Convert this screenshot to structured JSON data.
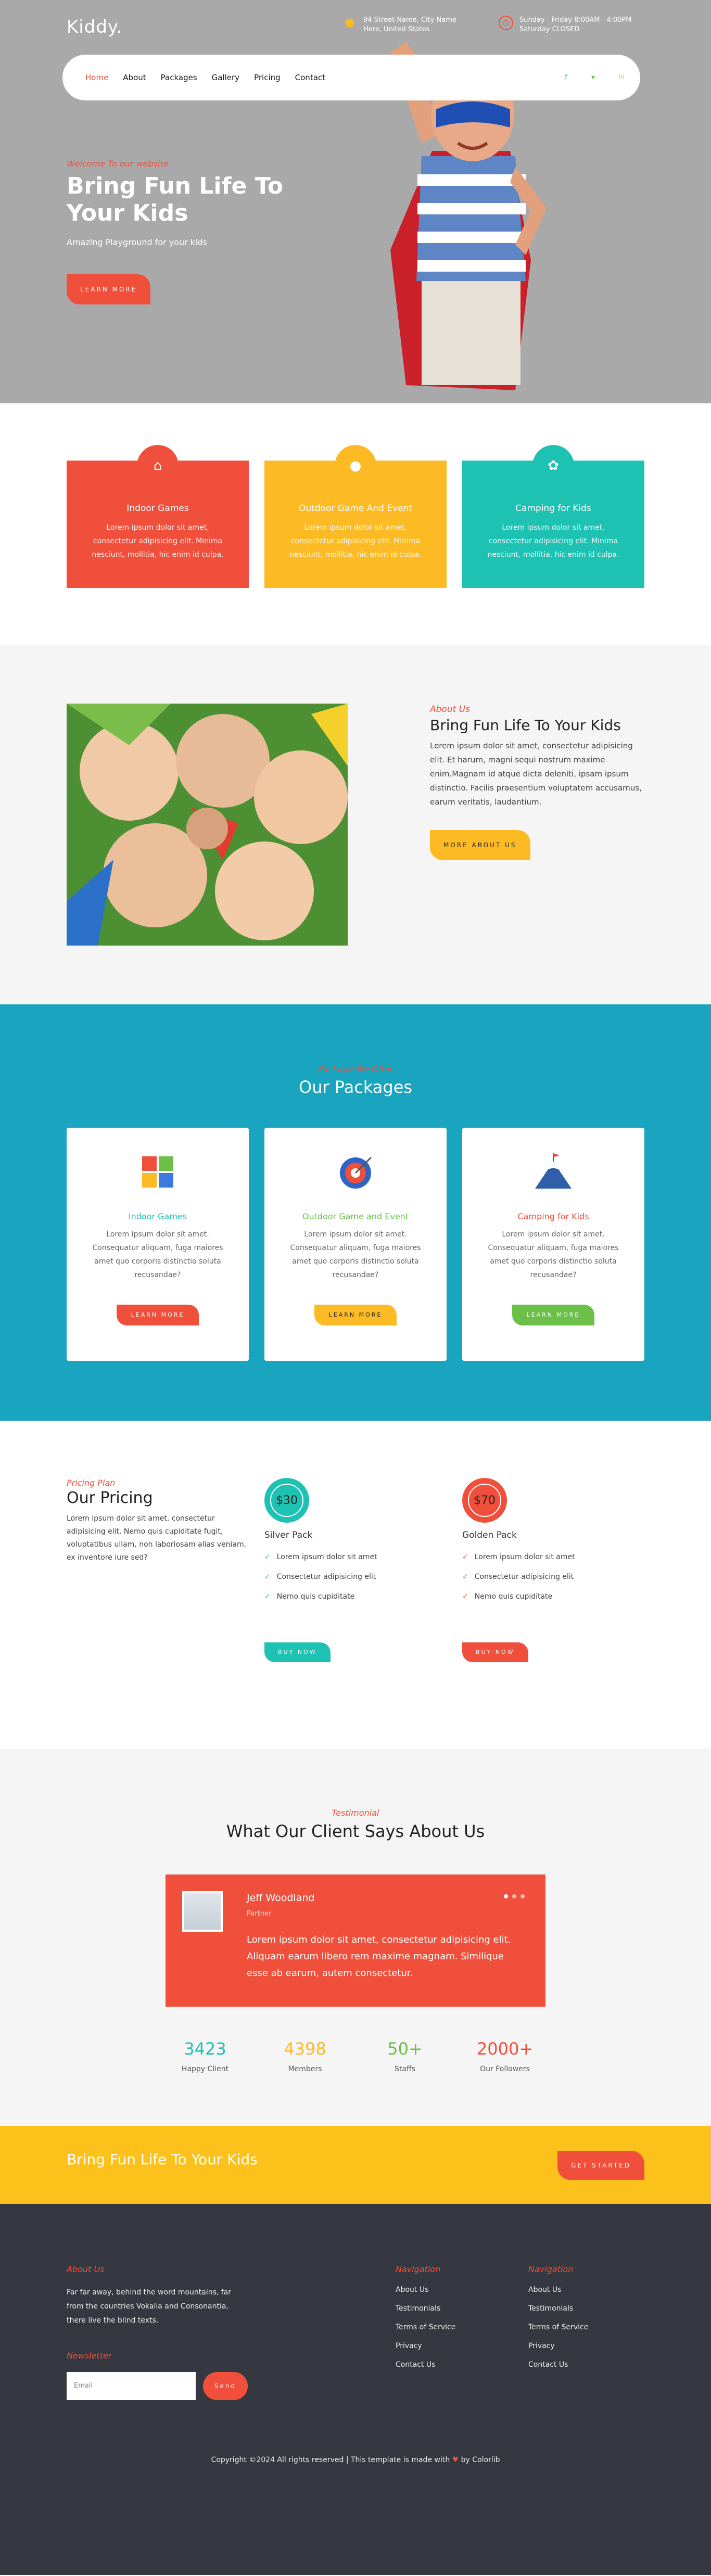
{
  "brand": {
    "logo": "Kiddy"
  },
  "topbar": {
    "address": "94 Street Name, City Name Here, United States",
    "hours": "Sunday - Friday 8:00AM - 4:00PM Saturday CLOSED"
  },
  "nav": {
    "items": [
      {
        "label": "Home",
        "active": true
      },
      {
        "label": "About"
      },
      {
        "label": "Packages"
      },
      {
        "label": "Gallery"
      },
      {
        "label": "Pricing"
      },
      {
        "label": "Contact"
      }
    ],
    "socials": [
      {
        "icon": "facebook-icon",
        "glyph": "f",
        "color": "#1ec2b3"
      },
      {
        "icon": "twitter-icon",
        "glyph": "▼",
        "color": "#6cc04a"
      },
      {
        "icon": "linkedin-icon",
        "glyph": "in",
        "color": "#fcba24"
      }
    ]
  },
  "hero": {
    "welcome": "Welcome To our website",
    "title_line1": "Bring Fun Life To",
    "title_line2": "Your Kids",
    "subtitle": "Amazing Playground for your kids",
    "button": "Learn More"
  },
  "services": [
    {
      "icon": "home-icon",
      "title": "Indoor Games",
      "text": "Lorem ipsum dolor sit amet, consectetur adipisicing elit. Minima nesciunt, mollitia, hic enim id culpa."
    },
    {
      "icon": "user-icon",
      "title": "Outdoor Game And Event",
      "text": "Lorem ipsum dolor sit amet, consectetur adipisicing elit. Minima nesciunt, mollitia, hic enim id culpa."
    },
    {
      "icon": "gear-icon",
      "title": "Camping for Kids",
      "text": "Lorem ipsum dolor sit amet, consectetur adipisicing elit. Minima nesciunt, mollitia, hic enim id culpa."
    }
  ],
  "about": {
    "label": "About Us",
    "title": "Bring Fun Life To Your Kids",
    "text": "Lorem ipsum dolor sit amet, consectetur adipisicing elit. Et harum, magni sequi nostrum maxime enim.Magnam id atque dicta deleniti, ipsam ipsum distinctio. Facilis praesentium voluptatem accusamus, earum veritatis, laudantium.",
    "button": "More About Us"
  },
  "packages": {
    "label": "Package We Offer",
    "title": "Our Packages",
    "items": [
      {
        "icon": "puzzle-icon",
        "title": "Indoor Games",
        "title_color": "#1ec2b3",
        "text": "Lorem ipsum dolor sit amet. Consequatur aliquam, fuga maiores amet quo corporis distinctio soluta recusandae?",
        "button": "Learn More",
        "btn_color": "#f0503b"
      },
      {
        "icon": "target-icon",
        "title": "Outdoor Game and Event",
        "title_color": "#6cc04a",
        "text": "Lorem ipsum dolor sit amet. Consequatur aliquam, fuga maiores amet quo corporis distinctio soluta recusandae?",
        "button": "Learn More",
        "btn_color": "#fcba24"
      },
      {
        "icon": "mountain-icon",
        "title": "Camping for Kids",
        "title_color": "#f0503b",
        "text": "Lorem ipsum dolor sit amet. Consequatur aliquam, fuga maiores amet quo corporis distinctio soluta recusandae?",
        "button": "Learn More",
        "btn_color": "#6cc04a"
      }
    ]
  },
  "pricing": {
    "label": "Pricing Plan",
    "title": "Our Pricing",
    "text": "Lorem ipsum dolor sit amet, consectetur adipisicing elit. Nemo quis cupiditate fugit, voluptatibus ullam, non laboriosam alias veniam, ex inventore iure sed?",
    "plans": [
      {
        "price": "$30",
        "name": "Silver Pack",
        "color": "#1ec2b3",
        "features": [
          "Lorem ipsum dolor sit amet",
          "Consectetur adipisicing elit",
          "Nemo quis cupiditate"
        ],
        "button": "Buy Now"
      },
      {
        "price": "$70",
        "name": "Golden Pack",
        "color": "#f0503b",
        "features": [
          "Lorem ipsum dolor sit amet",
          "Consectetur adipisicing elit",
          "Nemo quis cupiditate"
        ],
        "button": "Buy Now"
      }
    ]
  },
  "testimonial": {
    "label": "Testimonial",
    "title": "What Our Client Says About Us",
    "name": "Jeff Woodland",
    "role": "Partner",
    "quote": "Lorem ipsum dolor sit amet, consectetur adipisicing elit. Aliquam earum libero rem maxime magnam. Similique esse ab earum, autem consectetur.",
    "stats": [
      {
        "num": "3423",
        "label": "Happy Client",
        "color": "#1ec2b3"
      },
      {
        "num": "4398",
        "label": "Members",
        "color": "#fcba24"
      },
      {
        "num": "50+",
        "label": "Staffs",
        "color": "#6cc04a"
      },
      {
        "num": "2000+",
        "label": "Our Followers",
        "color": "#f0503b"
      }
    ]
  },
  "cta": {
    "title": "Bring Fun Life To Your Kids",
    "button": "Get Started"
  },
  "footer": {
    "about_title": "About Us",
    "about_text": "Far far away, behind the word mountains, far from the countries Vokalia and Consonantia, there live the blind texts.",
    "newsletter_title": "Newsletter",
    "email_placeholder": "Email",
    "send": "Send",
    "nav1_title": "Navigation",
    "nav2_title": "Navigation",
    "nav_links": [
      "About Us",
      "Testimonials",
      "Terms of Service",
      "Privacy",
      "Contact Us"
    ],
    "copyright_pre": "Copyright ©2024 All rights reserved | This template is made with",
    "copyright_post": "by Colorlib"
  }
}
